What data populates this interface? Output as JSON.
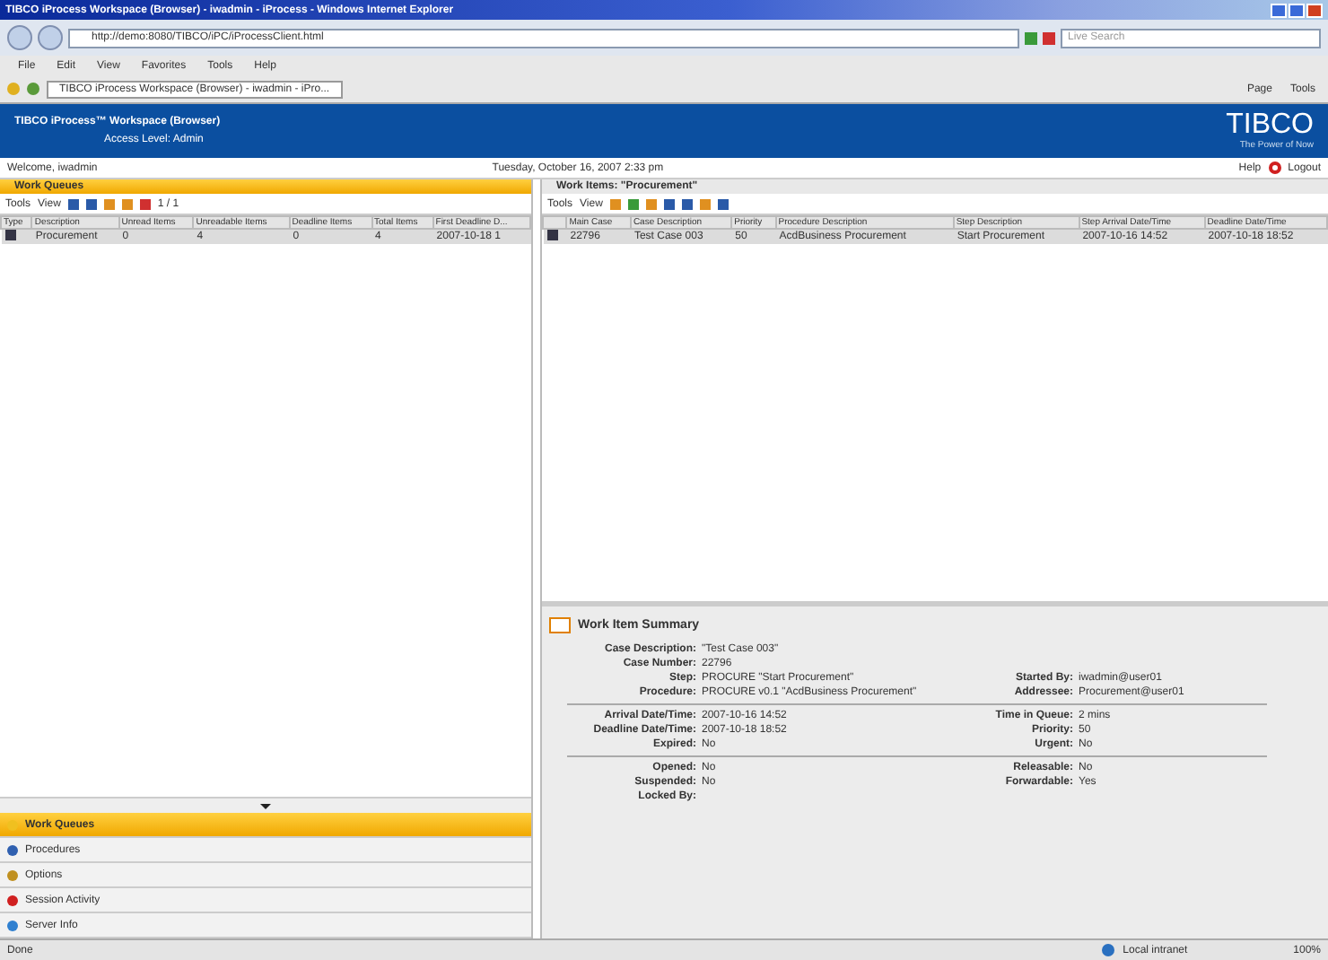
{
  "window": {
    "title": "TIBCO iProcess Workspace (Browser) - iwadmin - iProcess - Windows Internet Explorer"
  },
  "address_bar": {
    "url": "http://demo:8080/TIBCO/iPC/iProcessClient.html",
    "search_placeholder": "Live Search"
  },
  "menu": [
    "File",
    "Edit",
    "View",
    "Favorites",
    "Tools",
    "Help"
  ],
  "browser_tab": {
    "label": "TIBCO iProcess Workspace (Browser) - iwadmin - iPro..."
  },
  "browser_toolbar": [
    "Page",
    "Tools"
  ],
  "header": {
    "title": "TIBCO iProcess™ Workspace (Browser)",
    "access": "Access Level: Admin",
    "logo": "TIBCO",
    "tagline": "The Power of Now"
  },
  "welcome": "Welcome, iwadmin",
  "date": "Tuesday, October 16, 2007 2:33 pm",
  "help": "Help",
  "logout": "Logout",
  "work_queues": {
    "title": "Work Queues",
    "tools": "Tools",
    "view": "View",
    "page": "1 / 1",
    "type_header": "Type",
    "columns": [
      "Description",
      "Unread Items",
      "Unreadable Items",
      "Deadline Items",
      "Total Items",
      "First Deadline D..."
    ],
    "rows": [
      {
        "selected": false,
        "cells": [
          "Procurement",
          "0",
          "4",
          "0",
          "4",
          "2007-10-18 1"
        ]
      }
    ]
  },
  "work_items": {
    "title": "Work Items: \"Procurement\"",
    "tools": "Tools",
    "view": "View",
    "columns": [
      "Main Case",
      "Case Description",
      "Priority",
      "Procedure Description",
      "Step Description",
      "Step Arrival Date/Time",
      "Deadline Date/Time"
    ],
    "rows": [
      {
        "selected": false,
        "cells": [
          "22796",
          "Test Case 003",
          "50",
          "AcdBusiness Procurement",
          "Start Procurement",
          "2007-10-16 14:52",
          "2007-10-18 18:52"
        ]
      }
    ]
  },
  "summary": {
    "title": "Work Item Summary",
    "groups": [
      [
        {
          "label": "Case Description:",
          "value": "\"Test Case 003\""
        },
        {
          "label": "Case Number:",
          "value": "22796"
        },
        {
          "label": "Step:",
          "value": "PROCURE \"Start Procurement\"",
          "label2": "Started By:",
          "value2": "iwadmin@user01"
        },
        {
          "label": "Procedure:",
          "value": "PROCURE v0.1 \"AcdBusiness Procurement\"",
          "label2": "Addressee:",
          "value2": "Procurement@user01"
        }
      ],
      [
        {
          "label": "Arrival Date/Time:",
          "value": "2007-10-16 14:52",
          "label2": "Time in Queue:",
          "value2": "2 mins"
        },
        {
          "label": "Deadline Date/Time:",
          "value": "2007-10-18 18:52",
          "label2": "Priority:",
          "value2": "50"
        },
        {
          "label": "Expired:",
          "value": "No",
          "label2": "Urgent:",
          "value2": "No"
        }
      ],
      [
        {
          "label": "Opened:",
          "value": "No",
          "label2": "Releasable:",
          "value2": "No"
        },
        {
          "label": "Suspended:",
          "value": "No",
          "label2": "Forwardable:",
          "value2": "Yes"
        },
        {
          "label": "Locked By:"
        }
      ]
    ]
  },
  "nav": [
    {
      "label": "Work Queues",
      "selected": true,
      "color": "#f0c020"
    },
    {
      "label": "Procedures",
      "selected": false,
      "color": "#3060b0"
    },
    {
      "label": "Options",
      "selected": false,
      "color": "#c09020"
    },
    {
      "label": "Session Activity",
      "selected": false,
      "color": "#d02020"
    },
    {
      "label": "Server Info",
      "selected": false,
      "color": "#3080d0"
    }
  ],
  "status_bar": {
    "text": "Done",
    "zone": "Local intranet",
    "zoom": "100%"
  }
}
